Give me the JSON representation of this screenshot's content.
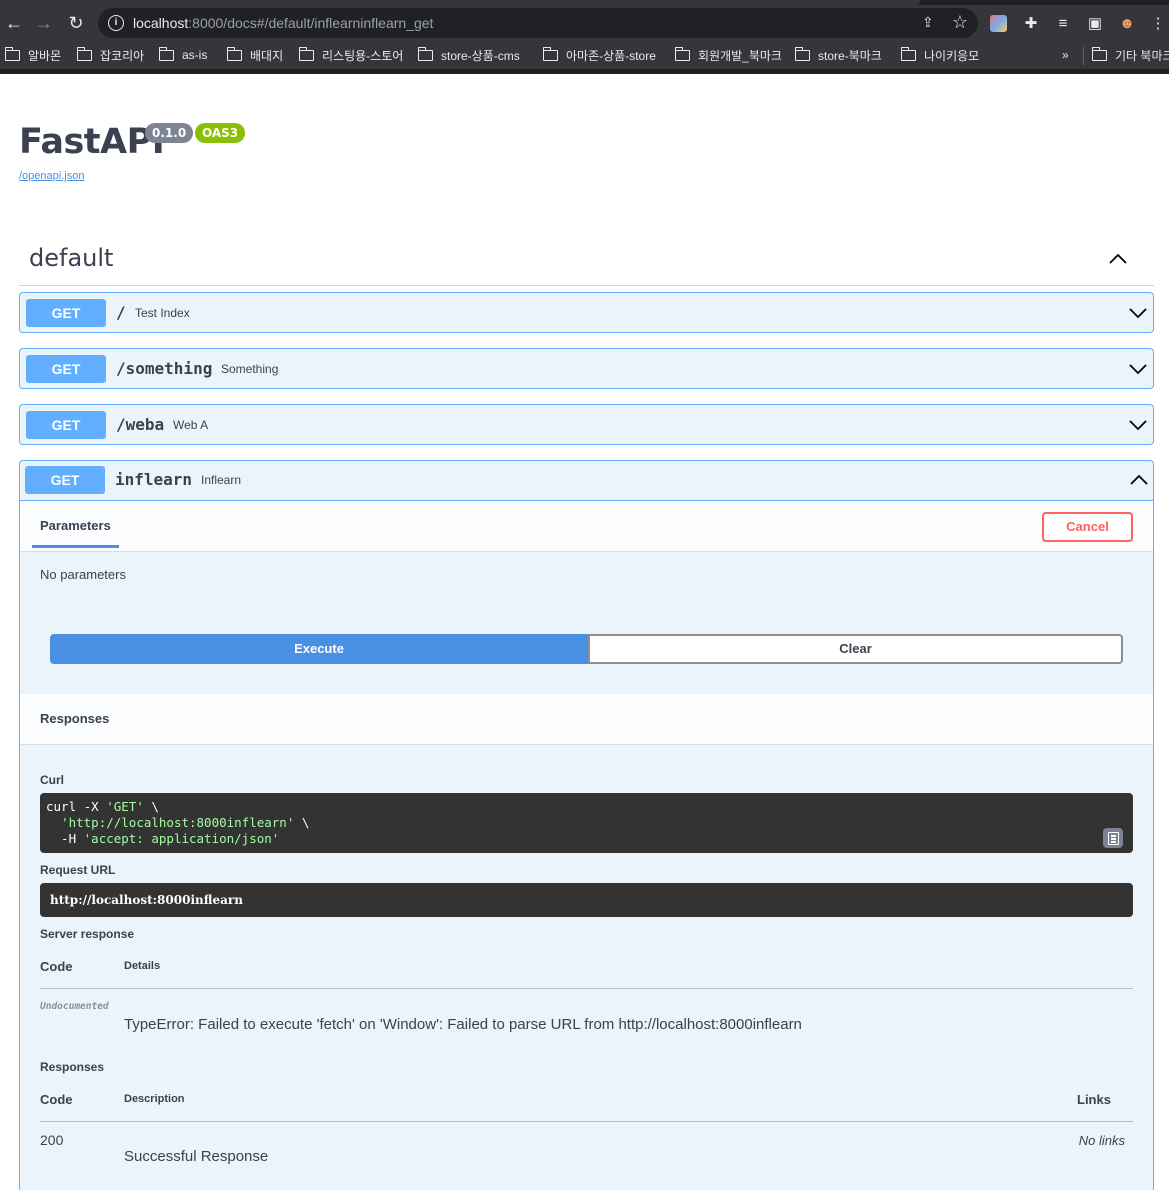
{
  "browser": {
    "url_host": "localhost",
    "url_rest": ":8000/docs#/default/inflearninflearn_get",
    "bookmarks": [
      "알바몬",
      "잡코리아",
      "as-is",
      "배대지",
      "리스팅용-스토어",
      "store-상품-cms",
      "아마존-상품-store",
      "회원개발_북마크",
      "store-북마크",
      "나이키응모"
    ],
    "more": "»",
    "other_bookmarks": "기타 북마크"
  },
  "page": {
    "title": "FastAPI",
    "version": "0.1.0",
    "oas": "OAS3",
    "openapi_link": "/openapi.json"
  },
  "tag": {
    "name": "default"
  },
  "operations": [
    {
      "method": "GET",
      "path": "/",
      "summary": "Test Index"
    },
    {
      "method": "GET",
      "path": "/something",
      "summary": "Something"
    },
    {
      "method": "GET",
      "path": "/weba",
      "summary": "Web A"
    },
    {
      "method": "GET",
      "path": "inflearn",
      "summary": "Inflearn"
    }
  ],
  "expanded": {
    "parameters_tab": "Parameters",
    "cancel": "Cancel",
    "no_params": "No parameters",
    "execute": "Execute",
    "clear": "Clear",
    "responses_header": "Responses",
    "curl_label": "Curl",
    "curl": {
      "l1_a": "curl -X ",
      "l1_b": "'GET'",
      "l1_c": " \\",
      "l2_a": "  ",
      "l2_b": "'http://localhost:8000inflearn'",
      "l2_c": " \\",
      "l3_a": "  -H ",
      "l3_b": "'accept: application/json'"
    },
    "request_url_label": "Request URL",
    "request_url": "http://localhost:8000inflearn",
    "server_response_label": "Server response",
    "code_col": "Code",
    "details_col": "Details",
    "undocumented": "Undocumented",
    "error_text": "TypeError: Failed to execute 'fetch' on 'Window': Failed to parse URL from http://localhost:8000inflearn",
    "responses_label": "Responses",
    "description_col": "Description",
    "links_col": "Links",
    "resp_code": "200",
    "resp_desc": "Successful Response",
    "no_links": "No links"
  }
}
